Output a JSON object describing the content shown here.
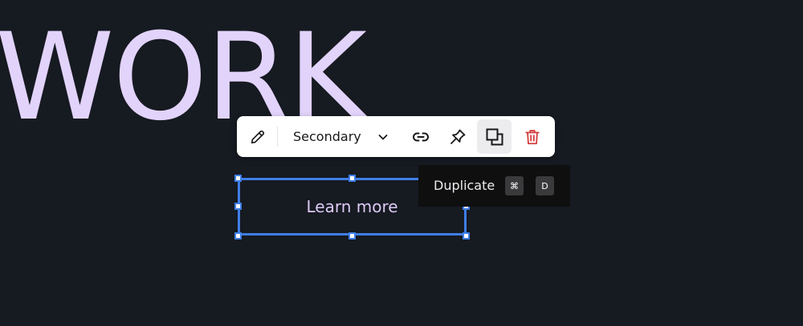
{
  "canvas": {
    "headline": "WORK"
  },
  "selected_element": {
    "label": "Learn more"
  },
  "toolbar": {
    "edit_icon": "pencil-icon",
    "variant_value": "Secondary",
    "variant_chevron_icon": "chevron-down-icon",
    "link_icon": "link-icon",
    "pin_icon": "pin-icon",
    "duplicate_icon": "duplicate-icon",
    "delete_icon": "trash-icon"
  },
  "tooltip": {
    "label": "Duplicate",
    "shortcut_keys": [
      "⌘",
      "D"
    ]
  },
  "colors": {
    "background": "#161a21",
    "headline": "#e2d3fb",
    "button_text": "#dccaf6",
    "selection": "#3f7ee6",
    "delete": "#d33b3b",
    "toolbar_bg": "#ffffff",
    "tooltip_bg": "#0f0f10"
  }
}
